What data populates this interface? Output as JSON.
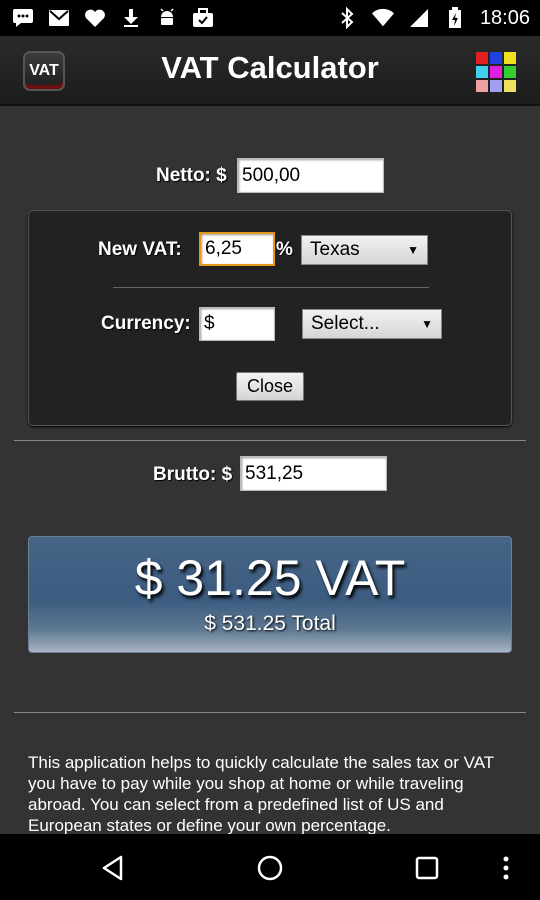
{
  "status_bar": {
    "time": "18:06",
    "left_icons": [
      "message-icon",
      "mail-icon",
      "heart-icon",
      "download-icon",
      "android-icon",
      "briefcase-icon"
    ],
    "right_icons": [
      "bluetooth-icon",
      "wifi-icon",
      "signal-icon",
      "battery-icon"
    ]
  },
  "title_bar": {
    "app_icon_label": "VAT",
    "title": "VAT Calculator",
    "grid_colors": [
      "#e02020",
      "#2040e0",
      "#f0e020",
      "#40d0f0",
      "#e020e0",
      "#30d030",
      "#f0a0a0",
      "#a0a0f0",
      "#f0e060"
    ]
  },
  "netto": {
    "label": "Netto: $",
    "value": "500,00"
  },
  "vat_panel": {
    "vat_label": "New VAT:",
    "vat_value": "6,25",
    "percent_sign": "%",
    "state_selected": "Texas",
    "currency_label": "Currency:",
    "currency_value": "$",
    "currency_select": "Select...",
    "close_label": "Close"
  },
  "brutto": {
    "label": "Brutto: $",
    "value": "531,25"
  },
  "result": {
    "vat_text": "$ 31.25 VAT",
    "total_text": "$ 531.25 Total"
  },
  "description": "This application helps to quickly calculate the sales tax or VAT you have to pay while you shop at home or while traveling abroad. You can select from a predefined list of US and European states or define your own percentage.",
  "colors": {
    "background": "#333333",
    "result_blue": "#466486",
    "focus_orange": "#e69a1a"
  }
}
